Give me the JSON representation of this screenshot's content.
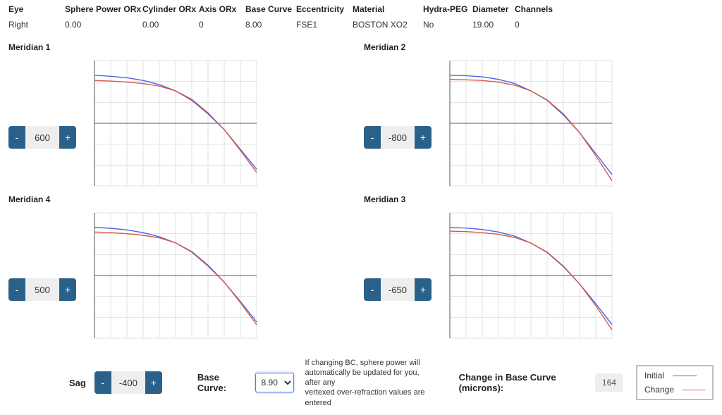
{
  "params": {
    "headers": {
      "eye": "Eye",
      "sphere": "Sphere Power ORx",
      "cylinder": "Cylinder ORx",
      "axis": "Axis ORx",
      "base_curve": "Base Curve",
      "eccentricity": "Eccentricity",
      "material": "Material",
      "hydra": "Hydra-PEG",
      "diameter": "Diameter",
      "channels": "Channels"
    },
    "values": {
      "eye": "Right",
      "sphere": "0.00",
      "cylinder": "0.00",
      "axis": "0",
      "base_curve": "8.00",
      "eccentricity": "FSE1",
      "material": "BOSTON XO2",
      "hydra": "No",
      "diameter": "19.00",
      "channels": "0"
    }
  },
  "m1": {
    "title": "Meridian 1",
    "value": "600"
  },
  "m2": {
    "title": "Meridian 2",
    "value": "-800"
  },
  "m3": {
    "title": "Meridian 3",
    "value": "-650"
  },
  "m4": {
    "title": "Meridian 4",
    "value": "500"
  },
  "sag": {
    "label": "Sag",
    "value": "-400"
  },
  "bc": {
    "label": "Base Curve:",
    "selected": "8.90"
  },
  "bc_note_l1": "If changing BC, sphere power will",
  "bc_note_l2": "automatically be updated for you, after any",
  "bc_note_l3": "vertexed over-refraction values are entered",
  "bc_change": {
    "label": "Change in Base Curve (microns):",
    "value": "164"
  },
  "legend": {
    "initial": "Initial",
    "change": "Change"
  },
  "buttons": {
    "minus": "-",
    "plus": "+"
  },
  "chart_data": [
    {
      "meridian": 1,
      "type": "line",
      "xlabel": "",
      "ylabel": "",
      "title": "",
      "x_range": [
        0,
        10
      ],
      "y_range": [
        -3,
        3
      ],
      "series": [
        {
          "name": "Initial",
          "color": "#4b63e6",
          "x": [
            0,
            1,
            2,
            3,
            4,
            5,
            6,
            7,
            8,
            9,
            10
          ],
          "y": [
            2.3,
            2.25,
            2.18,
            2.05,
            1.85,
            1.55,
            1.1,
            0.45,
            -0.3,
            -1.25,
            -2.2
          ]
        },
        {
          "name": "Change",
          "color": "#d65a4a",
          "x": [
            0,
            1,
            2,
            3,
            4,
            5,
            6,
            7,
            8,
            9,
            10
          ],
          "y": [
            2.05,
            2.02,
            1.97,
            1.9,
            1.78,
            1.55,
            1.15,
            0.5,
            -0.3,
            -1.3,
            -2.35
          ]
        }
      ]
    },
    {
      "meridian": 2,
      "type": "line",
      "x_range": [
        0,
        10
      ],
      "y_range": [
        -3,
        3
      ],
      "series": [
        {
          "name": "Initial",
          "color": "#4b63e6",
          "x": [
            0,
            1,
            2,
            3,
            4,
            5,
            6,
            7,
            8,
            9,
            10
          ],
          "y": [
            2.3,
            2.28,
            2.22,
            2.1,
            1.9,
            1.55,
            1.1,
            0.4,
            -0.45,
            -1.45,
            -2.45
          ]
        },
        {
          "name": "Change",
          "color": "#d65a4a",
          "x": [
            0,
            1,
            2,
            3,
            4,
            5,
            6,
            7,
            8,
            9,
            10
          ],
          "y": [
            2.1,
            2.08,
            2.05,
            1.97,
            1.82,
            1.55,
            1.12,
            0.45,
            -0.45,
            -1.55,
            -2.75
          ]
        }
      ]
    },
    {
      "meridian": 3,
      "type": "line",
      "x_range": [
        0,
        10
      ],
      "y_range": [
        -3,
        3
      ],
      "series": [
        {
          "name": "Initial",
          "color": "#4b63e6",
          "x": [
            0,
            1,
            2,
            3,
            4,
            5,
            6,
            7,
            8,
            9,
            10
          ],
          "y": [
            2.3,
            2.27,
            2.2,
            2.08,
            1.88,
            1.55,
            1.1,
            0.42,
            -0.4,
            -1.35,
            -2.35
          ]
        },
        {
          "name": "Change",
          "color": "#d65a4a",
          "x": [
            0,
            1,
            2,
            3,
            4,
            5,
            6,
            7,
            8,
            9,
            10
          ],
          "y": [
            2.12,
            2.1,
            2.05,
            1.97,
            1.82,
            1.55,
            1.12,
            0.45,
            -0.4,
            -1.45,
            -2.6
          ]
        }
      ]
    },
    {
      "meridian": 4,
      "type": "line",
      "x_range": [
        0,
        10
      ],
      "y_range": [
        -3,
        3
      ],
      "series": [
        {
          "name": "Initial",
          "color": "#4b63e6",
          "x": [
            0,
            1,
            2,
            3,
            4,
            5,
            6,
            7,
            8,
            9,
            10
          ],
          "y": [
            2.3,
            2.26,
            2.18,
            2.05,
            1.85,
            1.56,
            1.12,
            0.45,
            -0.32,
            -1.25,
            -2.22
          ]
        },
        {
          "name": "Change",
          "color": "#d65a4a",
          "x": [
            0,
            1,
            2,
            3,
            4,
            5,
            6,
            7,
            8,
            9,
            10
          ],
          "y": [
            2.08,
            2.05,
            2.0,
            1.92,
            1.8,
            1.56,
            1.15,
            0.5,
            -0.32,
            -1.3,
            -2.36
          ]
        }
      ]
    }
  ]
}
